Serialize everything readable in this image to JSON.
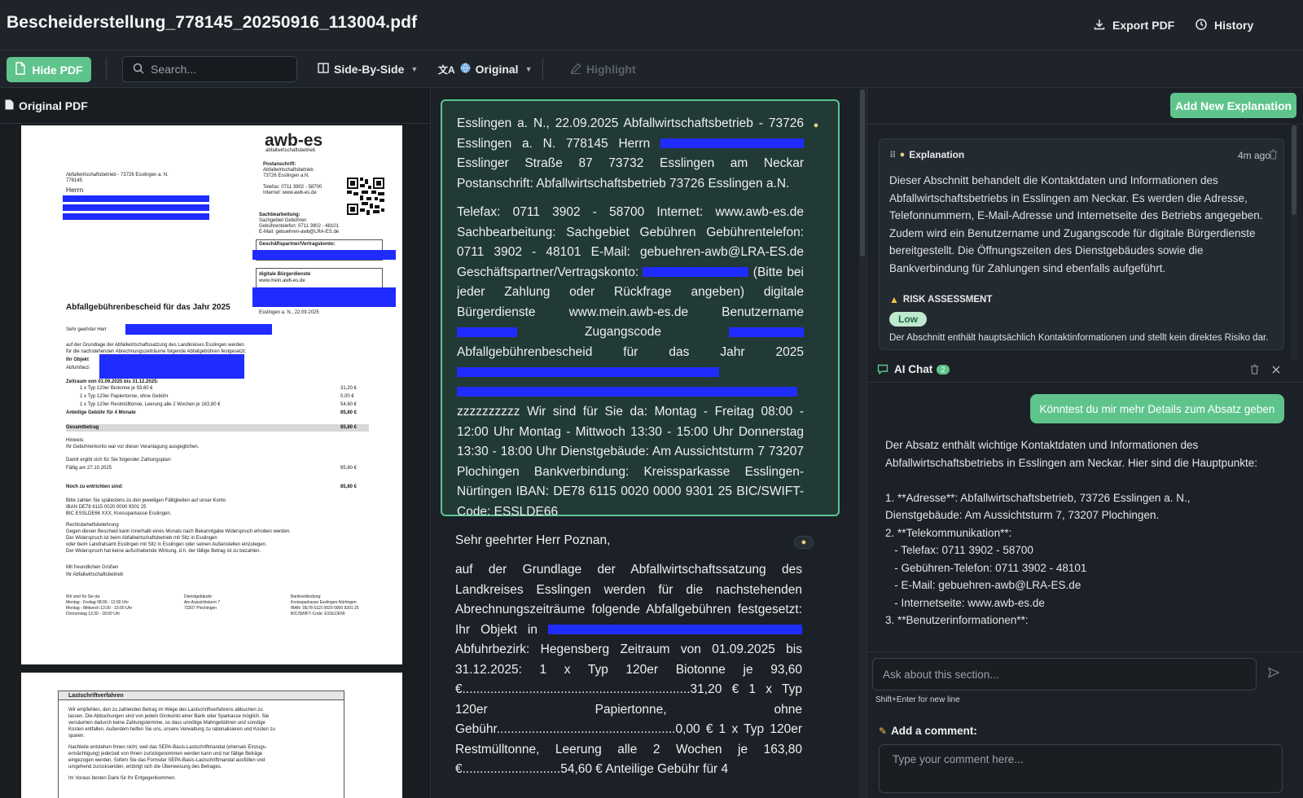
{
  "header": {
    "title": "Bescheiderstellung_778145_20250916_113004.pdf",
    "export_label": "Export PDF",
    "history_label": "History"
  },
  "toolbar": {
    "hide_pdf_label": "Hide PDF",
    "search_placeholder": "Search...",
    "view_mode_label": "Side-By-Side",
    "language_label": "Original",
    "highlight_label": "Highlight"
  },
  "left": {
    "header_label": "Original PDF",
    "page1": {
      "logo": "awb-es",
      "logo_sub": "abfallwirtschaftsbetrieb",
      "sender_line": "Abfallwirtschaftsbetrieb - 73726 Esslingen a. N.",
      "ref_number": "778145",
      "salutation_short": "Herrn",
      "postanschrift_label": "Postanschrift:",
      "postanschrift": [
        "Abfallwirtschaftsbetrieb",
        "73726 Esslingen a.N."
      ],
      "tel": "Telefax: 0711 3902 - 58700",
      "internet": "Internet: www.awb-es.de",
      "sachbearbeitung_label": "Sachbearbeitung:",
      "sachbearbeitung": [
        "Sachgebiet Gebühren",
        "Gebührentelefon: 0711 3902 - 48101",
        "E-Mail: gebuehren-awb@LRA-ES.de"
      ],
      "konto_label": "Geschäftspartner/Vertragskonto:",
      "buerger_label": "digitale Bürgerdienste",
      "buerger_url": "www.mein.awb-es.de",
      "date_line": "Esslingen a. N., 22.09.2025",
      "heading": "Abfallgebührenbescheid für das Jahr 2025",
      "greeting": "Sehr geehrter Herr",
      "intro1": "auf der Grundlage der Abfallwirtschaftssatzung des Landkreises Esslingen werden",
      "intro2": "für die nachstehenden Abrechnungszeiträume folgende Abfallgebühren festgesetzt:",
      "objekt": "Ihr Objekt",
      "bezirk": "Abfuhrbezi",
      "zeitraum": "Zeitraum von 01.09.2025 bis 31.12.2025:",
      "items": [
        {
          "label": "1 x Typ 120er Biotonne je 93,60 €",
          "amount": "31,20  €"
        },
        {
          "label": "1 x Typ 120er Papiertonne, ohne Gebühr",
          "amount": "0,00  €"
        },
        {
          "label": "1 x Typ 120er Restmülltonne, Leerung alle 2 Wochen je 163,80 €",
          "amount": "54,60  €"
        }
      ],
      "anteilig": {
        "label": "Anteilige Gebühr für 4 Monate",
        "amount": "85,80  €"
      },
      "gesamt": {
        "label": "Gesamtbetrag",
        "amount": "85,80  €"
      },
      "hinweis_label": "Hinweis:",
      "hinweis": "Ihr Gebührenkonto war vor dieser Veranlagung ausgeglichen.",
      "zahlungsplan": "Damit ergibt sich für Sie folgender Zahlungsplan:",
      "faellig": {
        "label": "Fällig am 27.10.2025",
        "amount": "85,80  €"
      },
      "noch": {
        "label": "Noch zu entrichten sind:",
        "amount": "85,80  €"
      },
      "bank": [
        "Bitte zahlen Sie spätestens zu den jeweiligen Fälligkeiten auf unser Konto",
        "IBAN DE78 6115 0020 0000 9301 25",
        "BIC ESSLDE66 XXX, Kreissparkasse Esslingen."
      ],
      "rechtsbehelf_label": "Rechtsbehelfsbelehrung",
      "rechtsbehelf": [
        "Gegen diesen Bescheid kann innerhalb eines Monats nach Bekanntgabe Widerspruch erhoben werden.",
        "Der Widerspruch ist beim Abfallwirtschaftsbetrieb mit Sitz in Esslingen",
        "oder beim Landratsamt Esslingen mit Sitz in Esslingen oder seinen Außenstellen einzulegen.",
        "Der Widerspruch hat keine aufschiebende Wirkung, d.h. der fällige Betrag ist zu bezahlen."
      ],
      "closing": [
        "Mit freundlichen Grüßen",
        "Ihr Abfallwirtschaftsbetrieb"
      ],
      "footer_hours": [
        "Wir sind für Sie da:",
        "Montag - Freitag    08:00 - 12:00 Uhr",
        "Montag - Mittwoch   13:30 - 15:00 Uhr",
        "Donnerstag          13:30 - 18:00 Uhr"
      ],
      "footer_building": [
        "Dienstgebäude:",
        "Am Aussichtsturm 7",
        "73207 Plochingen"
      ],
      "footer_bank": [
        "Bankverbindung:",
        "Kreissparkasse Esslingen-Nürtingen",
        "IBAN: DE78 6115 0020 0000 9301 25",
        "BIC/SWIFT-Code: ESSLDE66"
      ]
    },
    "page2": {
      "heading": "Lastschriftverfahren",
      "p1": [
        "Wir empfehlen, den zu zahlenden Betrag im Wege des Lastschriftverfahrens abbuchen zu",
        "lassen. Die Abbuchungen sind von jedem Girokonto einer Bank oder Sparkasse möglich. Sie",
        "versäumen dadurch keine Zahlungstermine, so dass unnötige Mahngebühren und sonstige",
        "Kosten entfallen. Außerdem helfen Sie uns, unsere Verwaltung zu rationalisieren und Kosten zu",
        "sparen."
      ],
      "p2": [
        "Nachteile entstehen Ihnen nicht, weil das SEPA-Basis-Lastschriftmandat (ehemals Einzugs-",
        "ermächtigung) jederzeit von Ihnen zurückgenommen werden kann und nur fällige Beträge",
        "eingezogen werden. Sofern Sie das Formular SEPA-Basis-Lastschriftmandat ausfüllen und",
        "umgehend zurücksenden, erübrigt sich die Überweisung des Betrages."
      ],
      "p3": "Im Voraus besten Dank für Ihr Entgegenkommen."
    }
  },
  "middle": {
    "para1_segments": [
      "Esslingen a. N., 22.09.2025 Abfallwirtschaftsbetrieb - 73726 Esslingen a. N. 778145 Herrn ",
      " Esslinger Straße 87 73732 Esslingen am Neckar Postanschrift: Abfallwirtschaftsbetrieb 73726 Esslingen a.N.",
      "Telefax: 0711 3902 - 58700 Internet: www.awb-es.de Sachbearbeitung: Sachgebiet Gebühren Gebührentelefon: 0711 3902 - 48101 E-Mail: gebuehren-awb@LRA-ES.de Geschäftspartner/Vertragskonto: ",
      " (Bitte bei jeder Zahlung oder Rückfrage angeben) digitale Bürgerdienste www.mein.awb-es.de Benutzername ",
      " Zugangscode ",
      "Abfallgebührenbescheid für das Jahr 2025 ",
      " zzzzzzzzzz Wir sind für Sie da: Montag - Freitag 08:00 - 12:00 Uhr Montag - Mittwoch 13:30 - 15:00 Uhr Donnerstag 13:30 - 18:00 Uhr Dienstgebäude: Am Aussichtsturm 7 73207 Plochingen Bankverbindung: Kreissparkasse Esslingen-Nürtingen IBAN: DE78 6115 0020 0000 9301 25 BIC/SWIFT-Code: ESSLDE66"
    ],
    "para2_greeting": "Sehr geehrter Herr Poznan,",
    "para2_segments": [
      "auf der Grundlage der Abfallwirtschaftssatzung des Landkreises Esslingen werden für die nachstehenden Abrechnungszeiträume folgende Abfallgebühren festgesetzt: Ihr Objekt in ",
      " Abfuhrbezirk: Hegensberg Zeitraum von 01.09.2025 bis 31.12.2025: 1 x Typ 120er Biotonne je 93,60 €.................................................................31,20 € 1 x Typ 120er Papiertonne, ohne Gebühr...................................................0,00 € 1 x Typ 120er Restmülltonne, Leerung alle 2 Wochen je 163,80 €............................54,60 € Anteilige Gebühr für 4"
    ]
  },
  "right": {
    "add_explanation_label": "Add New Explanation",
    "explanation": {
      "label": "Explanation",
      "time": "4m ago",
      "text": "Dieser Abschnitt behandelt die Kontaktdaten und Informationen des Abfallwirtschaftsbetriebs in Esslingen am Neckar. Es werden die Adresse, Telefonnummern, E-Mail-Adresse und Internetseite des Betriebs angegeben. Zudem wird ein Benutzername und Zugangscode für digitale Bürgerdienste bereitgestellt. Die Öffnungszeiten des Dienstgebäudes sowie die Bankverbindung für Zahlungen sind ebenfalls aufgeführt.",
      "risk_label": "RISK ASSESSMENT",
      "risk_level": "Low",
      "risk_text": "Der Abschnitt enthält hauptsächlich Kontaktinformationen und stellt kein direktes Risiko dar."
    },
    "chat": {
      "title": "AI Chat",
      "count": "2",
      "user_message": "Könntest du mir mehr Details zum Absatz geben",
      "ai_message": "Der Absatz enthält wichtige Kontaktdaten und Informationen des Abfallwirtschaftsbetriebs in Esslingen am Neckar. Hier sind die Hauptpunkte:\n\n1. **Adresse**: Abfallwirtschaftsbetrieb, 73726 Esslingen a. N., Dienstgebäude: Am Aussichtsturm 7, 73207 Plochingen.\n2. **Telekommunikation**:\n   - Telefax: 0711 3902 - 58700\n   - Gebühren-Telefon: 0711 3902 - 48101\n   - E-Mail: gebuehren-awb@LRA-ES.de\n   - Internetseite: www.awb-es.de\n3. **Benutzerinformationen**:",
      "input_placeholder": "Ask about this section...",
      "hint": "Shift+Enter for new line"
    },
    "comment": {
      "label": "Add a comment:",
      "placeholder": "Type your comment here..."
    }
  },
  "colors": {
    "accent": "#5ec48c",
    "background": "#1c2127",
    "highlight_para": "#223a35",
    "redaction": "#1f2cff"
  }
}
